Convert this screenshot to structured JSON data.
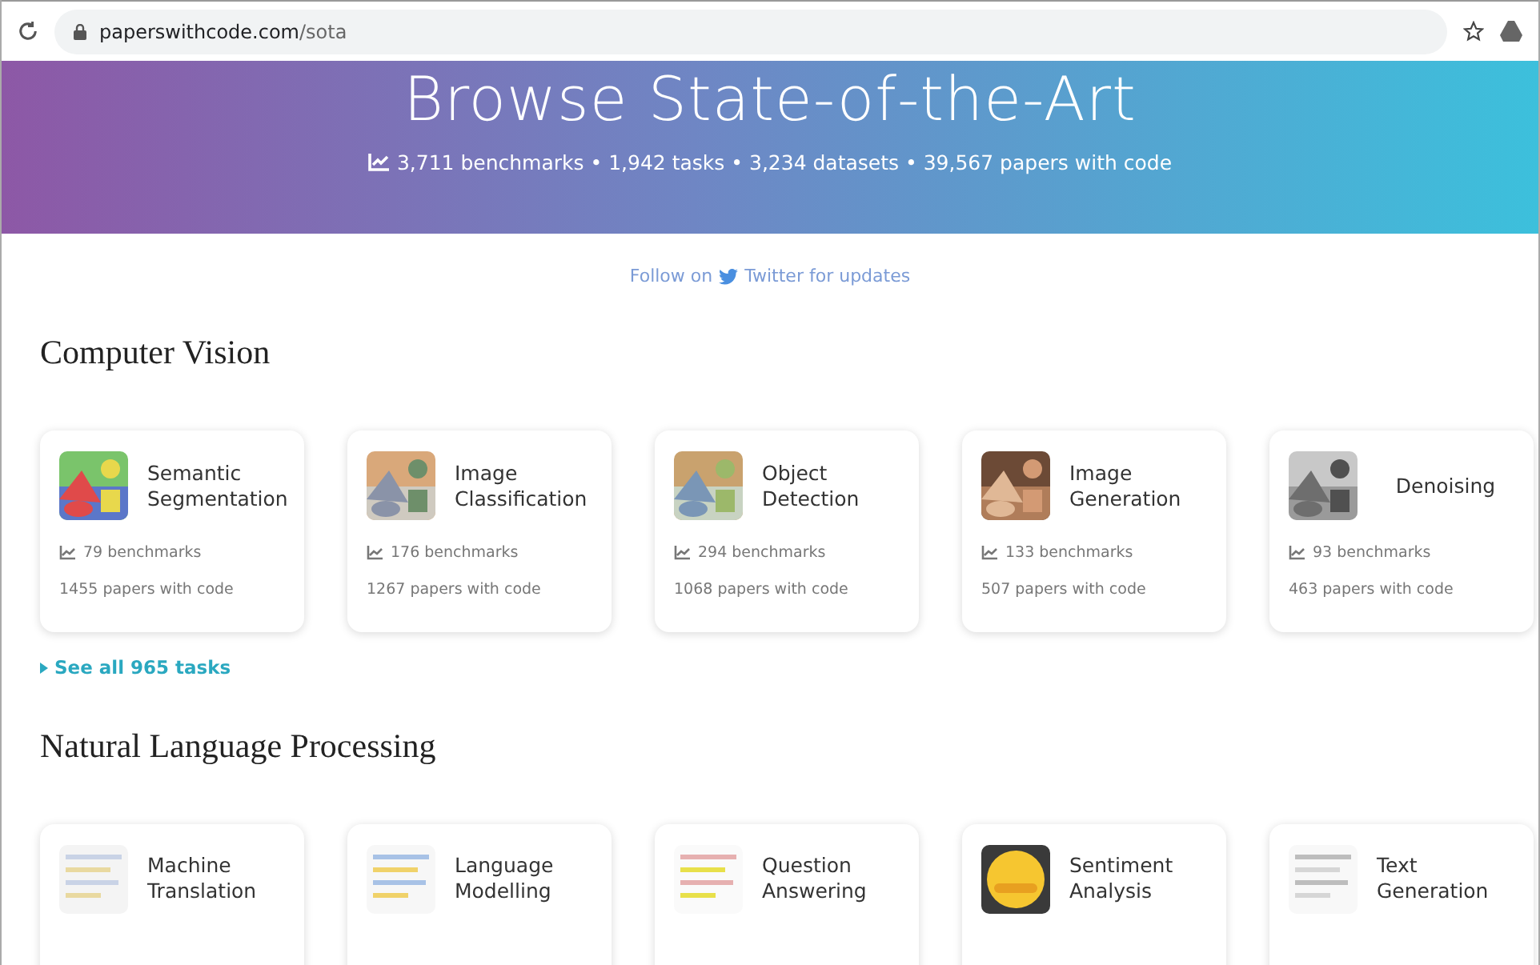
{
  "browser": {
    "url_host": "paperswithcode.com",
    "url_path": "/sota"
  },
  "hero": {
    "title": "Browse State-of-the-Art",
    "stats": "3,711 benchmarks • 1,942 tasks • 3,234 datasets • 39,567 papers with code"
  },
  "follow": {
    "prefix": "Follow on",
    "link": "Twitter for updates"
  },
  "sections": [
    {
      "title": "Computer Vision",
      "cards": [
        {
          "name": "Semantic Segmentation",
          "benchmarks": "79 benchmarks",
          "papers": "1455 papers with code"
        },
        {
          "name": "Image Classification",
          "benchmarks": "176 benchmarks",
          "papers": "1267 papers with code"
        },
        {
          "name": "Object Detection",
          "benchmarks": "294 benchmarks",
          "papers": "1068 papers with code"
        },
        {
          "name": "Image Generation",
          "benchmarks": "133 benchmarks",
          "papers": "507 papers with code"
        },
        {
          "name": "Denoising",
          "benchmarks": "93 benchmarks",
          "papers": "463 papers with code"
        }
      ],
      "see_all": "See all 965 tasks"
    },
    {
      "title": "Natural Language Processing",
      "cards": [
        {
          "name": "Machine Translation"
        },
        {
          "name": "Language Modelling"
        },
        {
          "name": "Question Answering"
        },
        {
          "name": "Sentiment Analysis"
        },
        {
          "name": "Text Generation"
        }
      ]
    }
  ]
}
